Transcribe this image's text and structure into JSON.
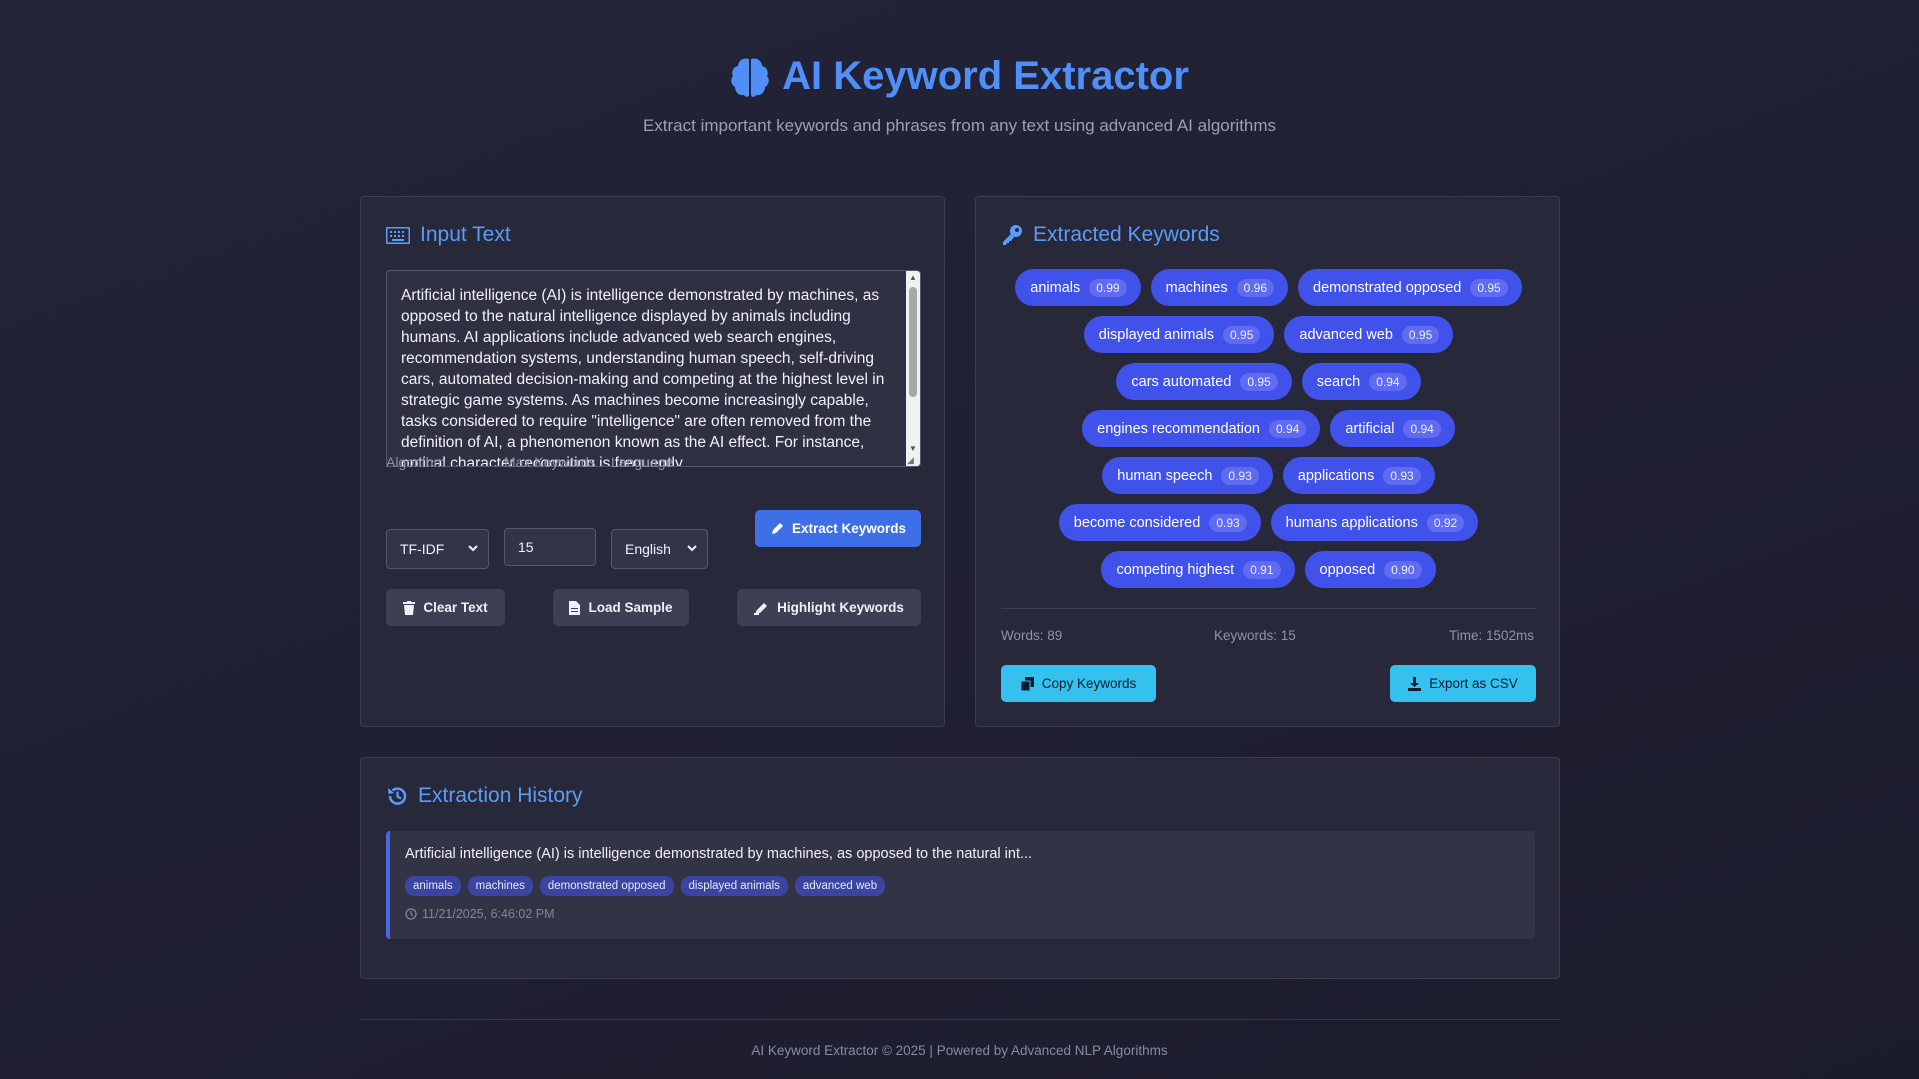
{
  "header": {
    "title": "AI Keyword Extractor",
    "subtitle": "Extract important keywords and phrases from any text using advanced AI algorithms",
    "icon": "brain-icon"
  },
  "input_panel": {
    "title": "Input Text",
    "icon": "keyboard-icon",
    "text": "Artificial intelligence (AI) is intelligence demonstrated by machines, as opposed to the natural intelligence displayed by animals including humans. AI applications include advanced web search engines, recommendation systems, understanding human speech, self-driving cars, automated decision-making and competing at the highest level in strategic game systems. As machines become increasingly capable, tasks considered to require \"intelligence\" are often removed from the definition of AI, a phenomenon known as the AI effect. For instance, optical character recognition is frequently",
    "algorithm_label": "Algorithm",
    "algorithm_value": "TF-IDF",
    "max_keywords_label": "Max Keywords",
    "max_keywords_value": "15",
    "language_label": "Language",
    "language_value": "English",
    "extract_button": "Extract Keywords",
    "clear_button": "Clear Text",
    "load_sample_button": "Load Sample",
    "highlight_button": "Highlight Keywords"
  },
  "keywords_panel": {
    "title": "Extracted Keywords",
    "icon": "key-icon",
    "rows": [
      [
        {
          "word": "animals",
          "score": "0.99"
        },
        {
          "word": "machines",
          "score": "0.96"
        },
        {
          "word": "demonstrated opposed",
          "score": "0.95"
        }
      ],
      [
        {
          "word": "displayed animals",
          "score": "0.95"
        },
        {
          "word": "advanced web",
          "score": "0.95"
        }
      ],
      [
        {
          "word": "cars automated",
          "score": "0.95"
        },
        {
          "word": "search",
          "score": "0.94"
        }
      ],
      [
        {
          "word": "engines recommendation",
          "score": "0.94"
        },
        {
          "word": "artificial",
          "score": "0.94"
        }
      ],
      [
        {
          "word": "human speech",
          "score": "0.93"
        },
        {
          "word": "applications",
          "score": "0.93"
        }
      ],
      [
        {
          "word": "become considered",
          "score": "0.93"
        },
        {
          "word": "humans applications",
          "score": "0.92"
        }
      ],
      [
        {
          "word": "competing highest",
          "score": "0.91"
        },
        {
          "word": "opposed",
          "score": "0.90"
        }
      ]
    ],
    "stats": {
      "words": "Words: 89",
      "keywords": "Keywords: 15",
      "time": "Time: 1502ms"
    },
    "copy_button": "Copy Keywords",
    "export_button": "Export as CSV"
  },
  "history_panel": {
    "title": "Extraction History",
    "icon": "history-icon",
    "items": [
      {
        "text": "Artificial intelligence (AI) is intelligence demonstrated by machines, as opposed to the natural int...",
        "tags": [
          "animals",
          "machines",
          "demonstrated opposed",
          "displayed animals",
          "advanced web"
        ],
        "timestamp": "11/21/2025, 6:46:02 PM"
      }
    ]
  },
  "footer": {
    "text": "AI Keyword Extractor © 2025 | Powered by Advanced NLP Algorithms"
  },
  "colors": {
    "accent": "#4f8ff7",
    "chip": "#4152ea",
    "primary_button": "#3e6fe6",
    "cyan_button": "#35c1ee",
    "background": "#212235"
  }
}
